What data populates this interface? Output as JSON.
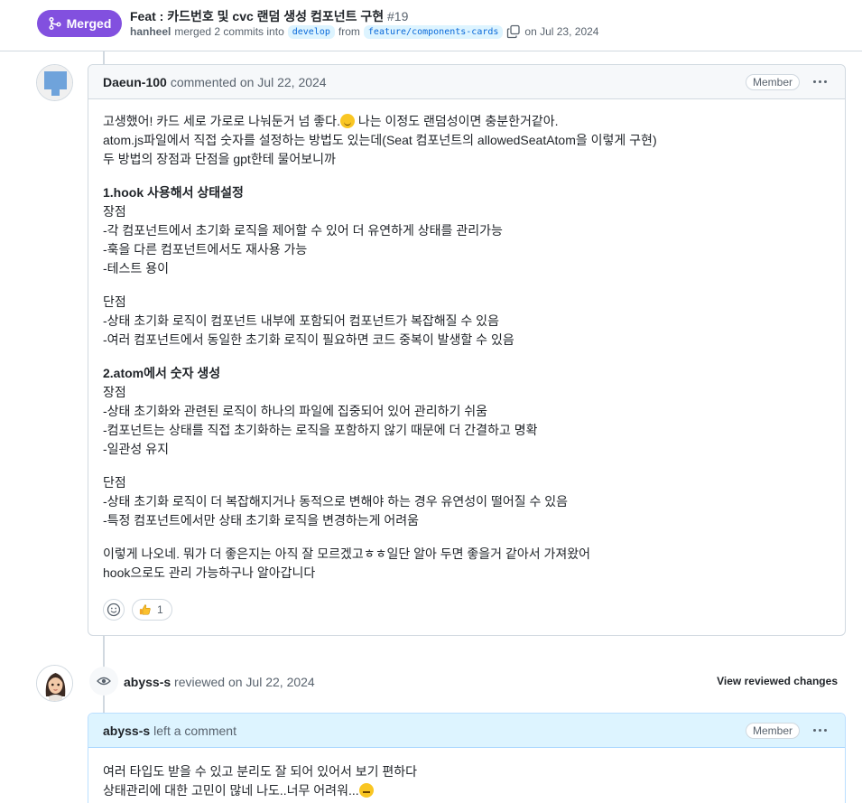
{
  "pr": {
    "status": "Merged",
    "title": "Feat : 카드번호 및 cvc 랜덤 생성 컴포넌트 구현",
    "number": "#19",
    "author": "hanheel",
    "merged_text": "merged 2 commits into",
    "base_branch": "develop",
    "from_text": "from",
    "head_branch": "feature/components-cards",
    "date": "on Jul 23, 2024"
  },
  "comment1": {
    "author": "Daeun-100",
    "when": "commented on Jul 22, 2024",
    "role": "Member",
    "lines": {
      "l1a": "고생했어! 카드 세로 가로로 나눠둔거 넘 좋다.",
      "l1b": " 나는 이정도 랜덤성이면 충분한거같아.",
      "l2": "atom.js파일에서 직접 숫자를 설정하는 방법도 있는데(Seat 컴포넌트의 allowedSeatAtom을 이렇게 구현)",
      "l3": "두 방법의 장점과 단점을 gpt한테 물어보니까",
      "h1": "1.hook 사용해서 상태설정",
      "p1_label": "장점",
      "p1_1": "-각 컴포넌트에서 초기화 로직을 제어할 수 있어 더 유연하게 상태를 관리가능",
      "p1_2": "-훅을 다른 컴포넌트에서도 재사용 가능",
      "p1_3": "-테스트 용이",
      "c1_label": "단점",
      "c1_1": "-상태 초기화 로직이 컴포넌트 내부에 포함되어 컴포넌트가 복잡해질 수 있음",
      "c1_2": "-여러 컴포넌트에서 동일한 초기화 로직이 필요하면 코드 중복이 발생할 수 있음",
      "h2": "2.atom에서 숫자 생성",
      "p2_label": "장점",
      "p2_1": "-상태 초기화와 관련된 로직이 하나의 파일에 집중되어 있어 관리하기 쉬움",
      "p2_2": "-컴포넌트는 상태를 직접 초기화하는 로직을 포함하지 않기 때문에 더 간결하고 명확",
      "p2_3": "-일관성 유지",
      "c2_label": "단점",
      "c2_1": "-상태 초기화 로직이 더 복잡해지거나 동적으로 변해야 하는 경우 유연성이 떨어질 수 있음",
      "c2_2": "-특정 컴포넌트에서만 상태 초기화 로직을 변경하는게 어려움",
      "end1": "이렇게 나오네. 뭐가 더 좋은지는 아직 잘 모르겠고ㅎㅎ일단 알아 두면 좋을거 같아서 가져왔어",
      "end2": "hook으로도 관리 가능하구나 알아갑니다"
    },
    "reaction_count": "1"
  },
  "review": {
    "author": "abyss-s",
    "when": "reviewed on Jul 22, 2024",
    "view_changes": "View reviewed changes"
  },
  "comment2": {
    "author": "abyss-s",
    "when": "left a comment",
    "role": "Member",
    "line1": "여러 타입도 받을 수 있고 분리도 잘 되어 있어서 보기 편하다",
    "line2": "상태관리에 대한 고민이 많네 나도..너무 어려워..."
  },
  "colors": {
    "merged": "#8250df",
    "link": "#0969da",
    "border": "#d1d9e0",
    "review_head": "#ddf4ff"
  }
}
